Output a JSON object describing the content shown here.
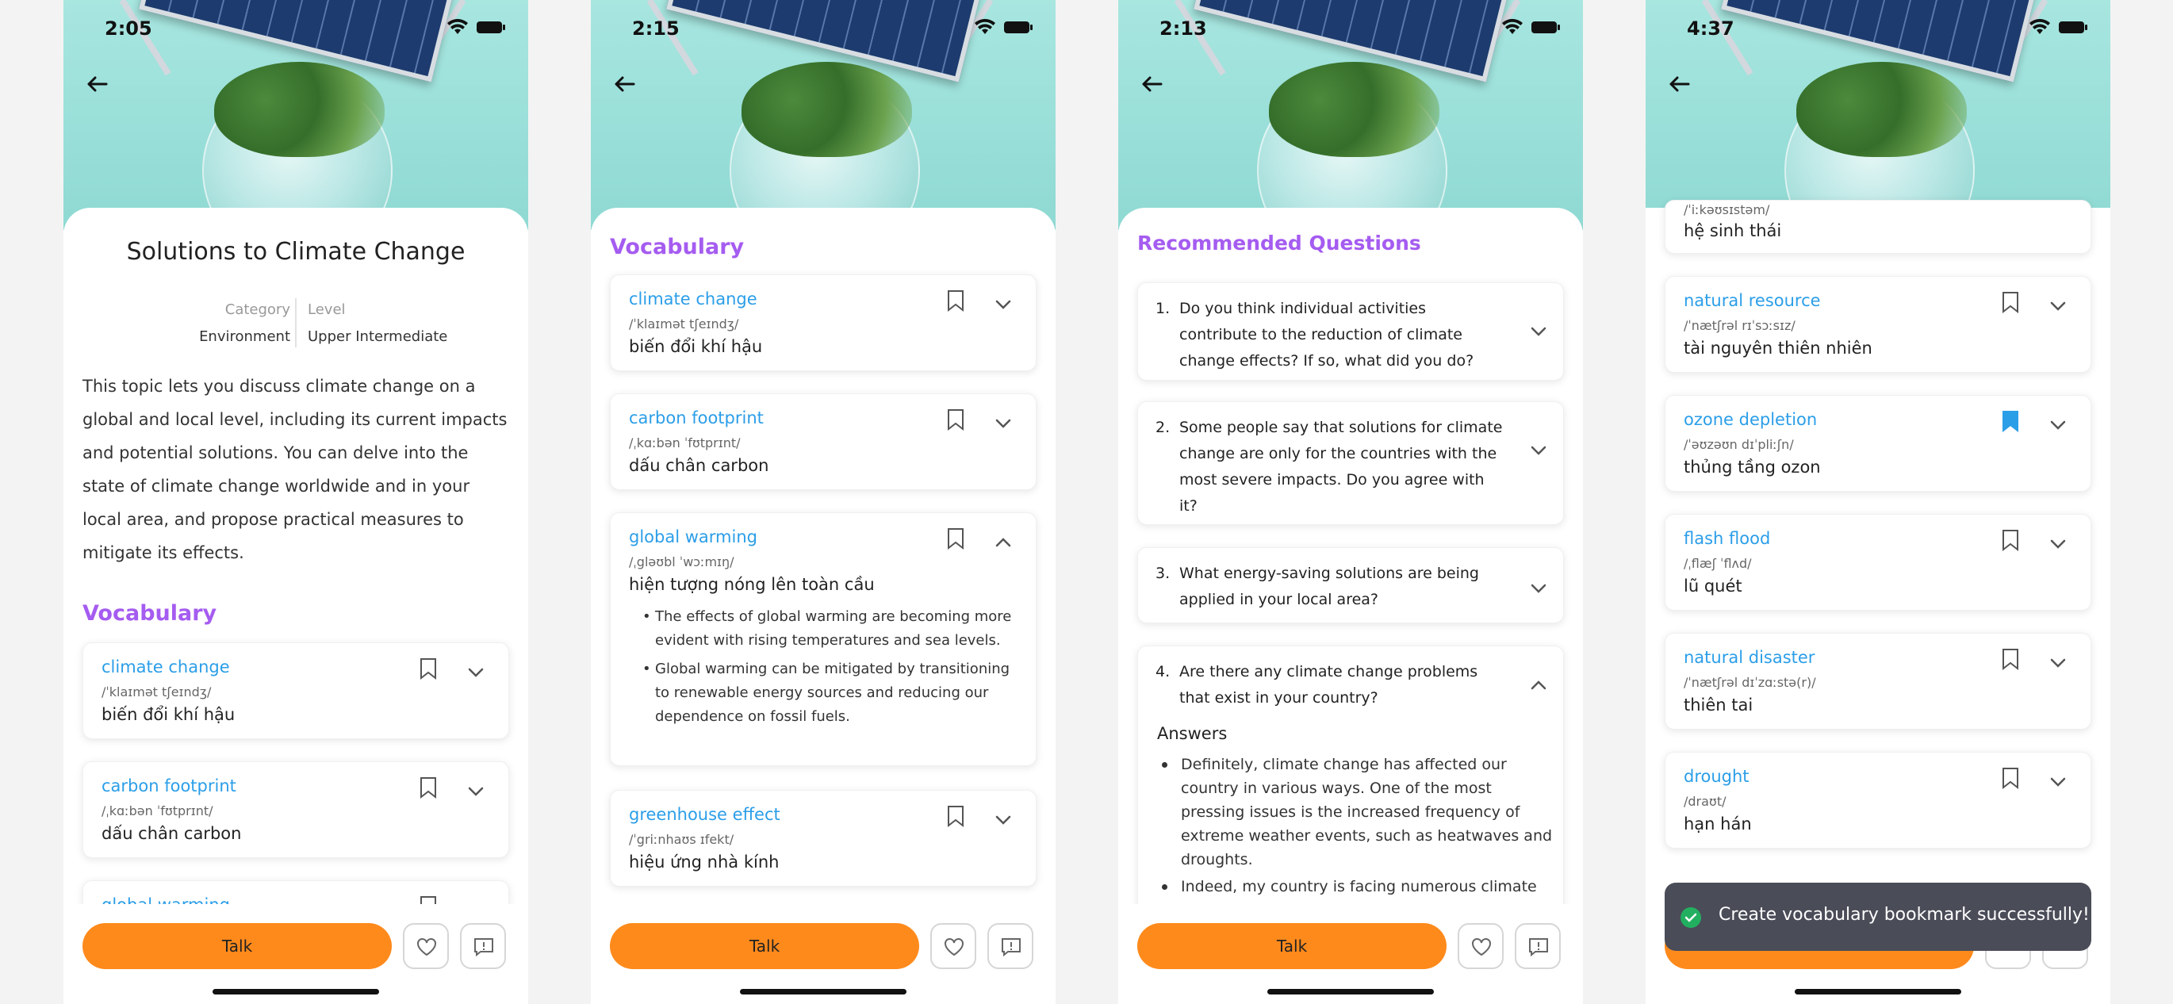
{
  "colors": {
    "accent": "#ff8a1c",
    "section_heading": "#a55cf0",
    "word": "#2b9ee8",
    "bookmark_active": "#2b9ee8",
    "toast_bg": "#4a4c58",
    "toast_ok": "#22b060"
  },
  "screen1": {
    "time": "2:05",
    "title": "Solutions to Climate Change",
    "category_label": "Category",
    "category_value": "Environment",
    "level_label": "Level",
    "level_value": "Upper Intermediate",
    "description": "This topic lets you discuss climate change on a global and local level, including its current impacts and potential solutions. You can delve into the state of climate change worldwide and in your local area, and propose practical measures to mitigate its effects.",
    "vocab_heading": "Vocabulary",
    "vocab": [
      {
        "word": "climate change",
        "ipa": "/ˈklaɪmət tʃeɪndʒ/",
        "meaning": "biến đổi khí hậu"
      },
      {
        "word": "carbon footprint",
        "ipa": "/ˌkɑːbən ˈfʊtprɪnt/",
        "meaning": "dấu chân carbon"
      },
      {
        "word": "global warming",
        "ipa": "",
        "meaning": ""
      }
    ],
    "talk": "Talk"
  },
  "screen2": {
    "time": "2:15",
    "vocab_heading": "Vocabulary",
    "vocab": [
      {
        "word": "climate change",
        "ipa": "/ˈklaɪmət tʃeɪndʒ/",
        "meaning": "biến đổi khí hậu"
      },
      {
        "word": "carbon footprint",
        "ipa": "/ˌkɑːbən ˈfʊtprɪnt/",
        "meaning": "dấu chân carbon"
      },
      {
        "word": "global warming",
        "ipa": "/ˌgləʊbl ˈwɔːmɪŋ/",
        "meaning": "hiện tượng nóng lên toàn cầu",
        "examples": [
          "The effects of global warming are becoming more evident with rising temperatures and sea levels.",
          "Global warming can be mitigated by transitioning to renewable energy sources and reducing our dependence on fossil fuels."
        ]
      },
      {
        "word": "greenhouse effect",
        "ipa": "/ˈgriːnhaʊs ɪfekt/",
        "meaning": "hiệu ứng nhà kính"
      }
    ],
    "talk": "Talk"
  },
  "screen3": {
    "time": "2:13",
    "heading": "Recommended Questions",
    "questions": [
      {
        "num": "1.",
        "text": "Do you think individual activities contribute to the reduction of climate change effects? If so, what did you do?"
      },
      {
        "num": "2.",
        "text": "Some people say that solutions for climate change are only for the countries with the most severe impacts. Do you agree with it?"
      },
      {
        "num": "3.",
        "text": "What energy-saving solutions are being applied in your local area?"
      },
      {
        "num": "4.",
        "text": "Are there any climate change problems that exist in your country?"
      }
    ],
    "answers_label": "Answers",
    "answers": [
      "Definitely, climate change has affected our country in various ways. One of the most pressing issues is the increased frequency of extreme weather events, such as heatwaves and droughts.",
      "Indeed, my country is facing numerous climate change problems. For example, there has been a"
    ],
    "talk": "Talk"
  },
  "screen4": {
    "time": "4:37",
    "partial_ipa": "/ˈiːkəʊsɪstəm/",
    "partial_meaning": "hệ sinh thái",
    "vocab": [
      {
        "word": "natural resource",
        "ipa": "/ˈnætʃrəl rɪˈsɔːsɪz/",
        "meaning": "tài nguyên thiên nhiên",
        "bookmarked": false
      },
      {
        "word": "ozone depletion",
        "ipa": "/ˈəʊzəʊn dɪˈpliːʃn/",
        "meaning": "thủng tầng ozon",
        "bookmarked": true
      },
      {
        "word": "flash flood",
        "ipa": "/ˌflæʃ ˈflʌd/",
        "meaning": "lũ quét",
        "bookmarked": false
      },
      {
        "word": "natural disaster",
        "ipa": "/ˈnætʃrəl dɪˈzɑːstə(r)/",
        "meaning": "thiên tai",
        "bookmarked": false
      },
      {
        "word": "drought",
        "ipa": "/draʊt/",
        "meaning": "hạn hán",
        "bookmarked": false
      }
    ],
    "toast": "Create vocabulary bookmark successfully!"
  }
}
